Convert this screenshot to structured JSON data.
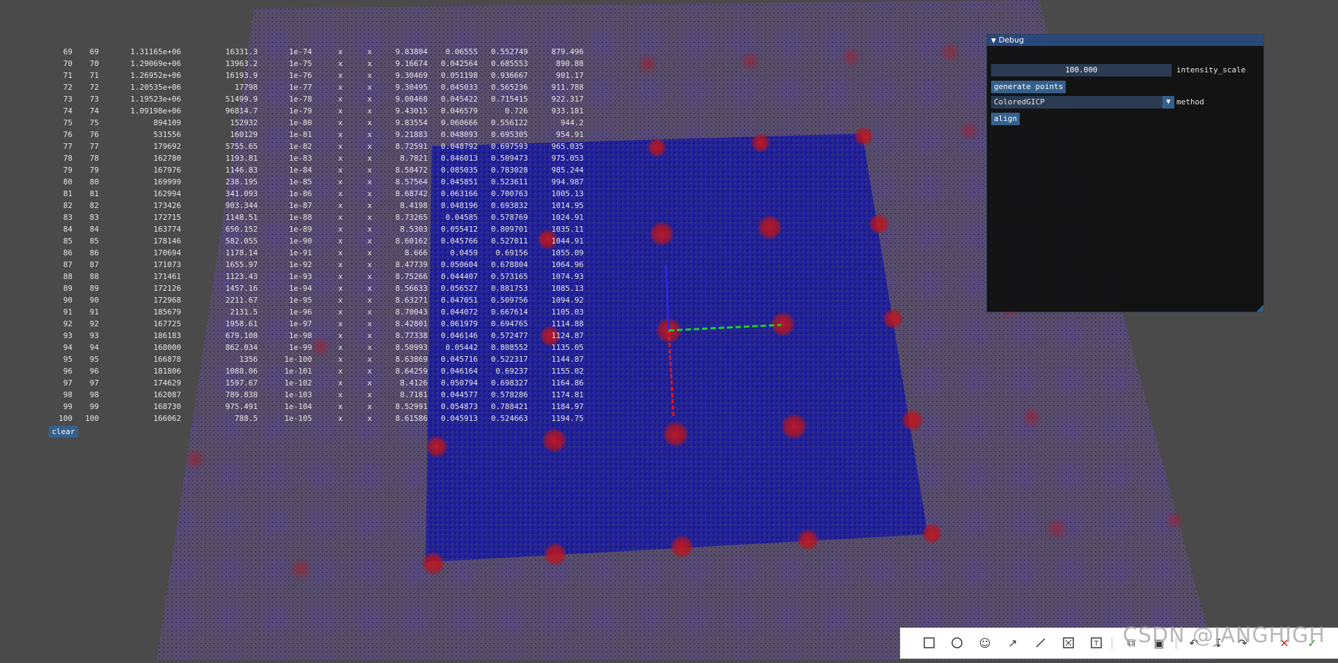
{
  "colors": {
    "background": "#4a4a4a",
    "ground_plane": "#5f5473",
    "target_square": "#1f1fa0",
    "red_blob": "#b4141e",
    "axis_x": "#e01818",
    "axis_y": "#20d020",
    "axis_z": "#2222d0",
    "button": "#35608c",
    "panel_title": "#29487a"
  },
  "log": {
    "rows": [
      [
        "69",
        "69",
        "1.31165e+06",
        "16331.3",
        "1e-74",
        "x",
        "x",
        "9.83804",
        "0.06555",
        "0.552749",
        "879.496"
      ],
      [
        "70",
        "70",
        "1.29069e+06",
        "13963.2",
        "1e-75",
        "x",
        "x",
        "9.16674",
        "0.042564",
        "0.685553",
        "890.88"
      ],
      [
        "71",
        "71",
        "1.26952e+06",
        "16193.9",
        "1e-76",
        "x",
        "x",
        "9.30469",
        "0.051198",
        "0.936667",
        "901.17"
      ],
      [
        "72",
        "72",
        "1.20535e+06",
        "17798",
        "1e-77",
        "x",
        "x",
        "9.30495",
        "0.045033",
        "0.565236",
        "911.788"
      ],
      [
        "73",
        "73",
        "1.19523e+06",
        "51499.9",
        "1e-78",
        "x",
        "x",
        "9.08468",
        "0.045422",
        "0.715415",
        "922.317"
      ],
      [
        "74",
        "74",
        "1.09198e+06",
        "96814.7",
        "1e-79",
        "x",
        "x",
        "9.43015",
        "0.046579",
        "0.726",
        "933.181"
      ],
      [
        "75",
        "75",
        "894109",
        "152932",
        "1e-80",
        "x",
        "x",
        "9.83554",
        "0.060666",
        "0.556122",
        "944.2"
      ],
      [
        "76",
        "76",
        "531556",
        "160129",
        "1e-81",
        "x",
        "x",
        "9.21883",
        "0.048093",
        "0.695305",
        "954.91"
      ],
      [
        "77",
        "77",
        "179692",
        "5755.65",
        "1e-82",
        "x",
        "x",
        "8.72591",
        "0.048792",
        "0.697593",
        "965.035"
      ],
      [
        "78",
        "78",
        "162780",
        "1193.81",
        "1e-83",
        "x",
        "x",
        "8.7821",
        "0.046013",
        "0.509473",
        "975.053"
      ],
      [
        "79",
        "79",
        "167976",
        "1146.83",
        "1e-84",
        "x",
        "x",
        "8.58472",
        "0.085035",
        "0.783028",
        "985.244"
      ],
      [
        "80",
        "80",
        "169999",
        "238.195",
        "1e-85",
        "x",
        "x",
        "8.57564",
        "0.045851",
        "0.523611",
        "994.987"
      ],
      [
        "81",
        "81",
        "162994",
        "341.093",
        "1e-86",
        "x",
        "x",
        "8.68742",
        "0.063166",
        "0.700763",
        "1005.13"
      ],
      [
        "82",
        "82",
        "173426",
        "903.344",
        "1e-87",
        "x",
        "x",
        "8.4198",
        "0.048196",
        "0.693832",
        "1014.95"
      ],
      [
        "83",
        "83",
        "172715",
        "1148.51",
        "1e-88",
        "x",
        "x",
        "8.73265",
        "0.04585",
        "0.578769",
        "1024.91"
      ],
      [
        "84",
        "84",
        "163774",
        "650.152",
        "1e-89",
        "x",
        "x",
        "8.5303",
        "0.055412",
        "0.809701",
        "1035.11"
      ],
      [
        "85",
        "85",
        "178146",
        "582.055",
        "1e-90",
        "x",
        "x",
        "8.60162",
        "0.045766",
        "0.527011",
        "1044.91"
      ],
      [
        "86",
        "86",
        "170694",
        "1178.14",
        "1e-91",
        "x",
        "x",
        "8.666",
        "0.0459",
        "0.69156",
        "1055.09"
      ],
      [
        "87",
        "87",
        "171073",
        "1655.97",
        "1e-92",
        "x",
        "x",
        "8.47739",
        "0.050604",
        "0.678804",
        "1064.96"
      ],
      [
        "88",
        "88",
        "171461",
        "1123.43",
        "1e-93",
        "x",
        "x",
        "8.75266",
        "0.044407",
        "0.573165",
        "1074.93"
      ],
      [
        "89",
        "89",
        "172126",
        "1457.16",
        "1e-94",
        "x",
        "x",
        "8.56633",
        "0.056527",
        "0.881753",
        "1085.13"
      ],
      [
        "90",
        "90",
        "172968",
        "2211.67",
        "1e-95",
        "x",
        "x",
        "8.63271",
        "0.047051",
        "0.509756",
        "1094.92"
      ],
      [
        "91",
        "91",
        "185679",
        "2131.5",
        "1e-96",
        "x",
        "x",
        "8.70043",
        "0.044072",
        "0.667614",
        "1105.03"
      ],
      [
        "92",
        "92",
        "167725",
        "1958.61",
        "1e-97",
        "x",
        "x",
        "8.42801",
        "0.061979",
        "0.694765",
        "1114.88"
      ],
      [
        "93",
        "93",
        "186183",
        "679.108",
        "1e-98",
        "x",
        "x",
        "8.77338",
        "0.046146",
        "0.572477",
        "1124.87"
      ],
      [
        "94",
        "94",
        "168000",
        "862.034",
        "1e-99",
        "x",
        "x",
        "8.50993",
        "0.05442",
        "0.808552",
        "1135.05"
      ],
      [
        "95",
        "95",
        "166878",
        "1356",
        "1e-100",
        "x",
        "x",
        "8.63869",
        "0.045716",
        "0.522317",
        "1144.87"
      ],
      [
        "96",
        "96",
        "181806",
        "1088.06",
        "1e-101",
        "x",
        "x",
        "8.64259",
        "0.046164",
        "0.69237",
        "1155.02"
      ],
      [
        "97",
        "97",
        "174629",
        "1597.67",
        "1e-102",
        "x",
        "x",
        "8.4126",
        "0.050794",
        "0.698327",
        "1164.86"
      ],
      [
        "98",
        "98",
        "162087",
        "789.838",
        "1e-103",
        "x",
        "x",
        "8.7181",
        "0.044577",
        "0.578286",
        "1174.81"
      ],
      [
        "99",
        "99",
        "168730",
        "975.491",
        "1e-104",
        "x",
        "x",
        "8.52991",
        "0.054873",
        "0.788421",
        "1184.97"
      ],
      [
        "100",
        "100",
        "166062",
        "788.5",
        "1e-105",
        "x",
        "x",
        "8.61586",
        "0.045913",
        "0.524663",
        "1194.75"
      ]
    ],
    "clear_label": "clear"
  },
  "debug": {
    "title": "Debug",
    "intensity_value": "100.000",
    "intensity_label": "intensity_scale",
    "generate_label": "generate points",
    "method_value": "ColoredGICP",
    "method_label": "method",
    "align_label": "align"
  },
  "toolbar": {
    "icons": [
      "rectangle-icon",
      "circle-icon",
      "emoji-icon",
      "arrow-icon",
      "line-icon",
      "mosaic-icon",
      "text-icon",
      "pin-icon",
      "ocr-icon",
      "undo-icon",
      "redo-icon",
      "cancel-icon",
      "confirm-icon"
    ]
  },
  "watermark": "CSDN @JANGHIGH"
}
